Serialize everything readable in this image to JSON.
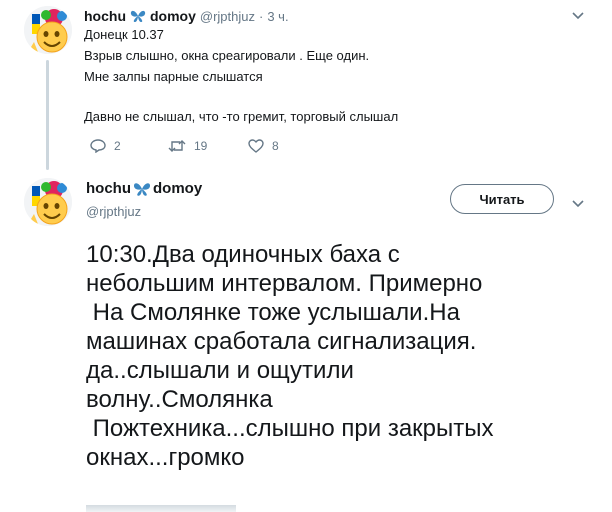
{
  "tweet1": {
    "name": "hochu",
    "name_suffix": "domoy",
    "handle": "@rjpthjuz",
    "dot": "·",
    "time": "3 ч.",
    "lines": [
      "Донецк 10.37",
      "Взрыв слышно, окна среагировали . Еще один.",
      "Мне залпы парные слышатся",
      "",
      "Давно не слышал, что -то гремит, торговый слышал"
    ],
    "actions": {
      "reply_count": "2",
      "retweet_count": "19",
      "like_count": "8"
    }
  },
  "tweet2": {
    "name": "hochu",
    "name_suffix": "domoy",
    "handle": "@rjpthjuz",
    "follow_label": "Читать",
    "lines": [
      "10:30.Два одиночных баха с",
      "небольшим интервалом. Примерно",
      " На Смолянке тоже услышали.На",
      "машинах сработала сигнализация.",
      "да..слышали и ощутили",
      "волну..Смолянка",
      " Пожтехника...слышно при закрытых",
      "окнах...громко"
    ]
  },
  "icons": {
    "butterfly": "butterfly-emoji",
    "chevron": "chevron-down-icon",
    "reply": "reply-icon",
    "retweet": "retweet-icon",
    "like": "heart-icon",
    "avatar": "emoji-avatar"
  },
  "colors": {
    "secondary": "#657786",
    "text": "#14171a",
    "butterfly": "#3b88c3"
  }
}
